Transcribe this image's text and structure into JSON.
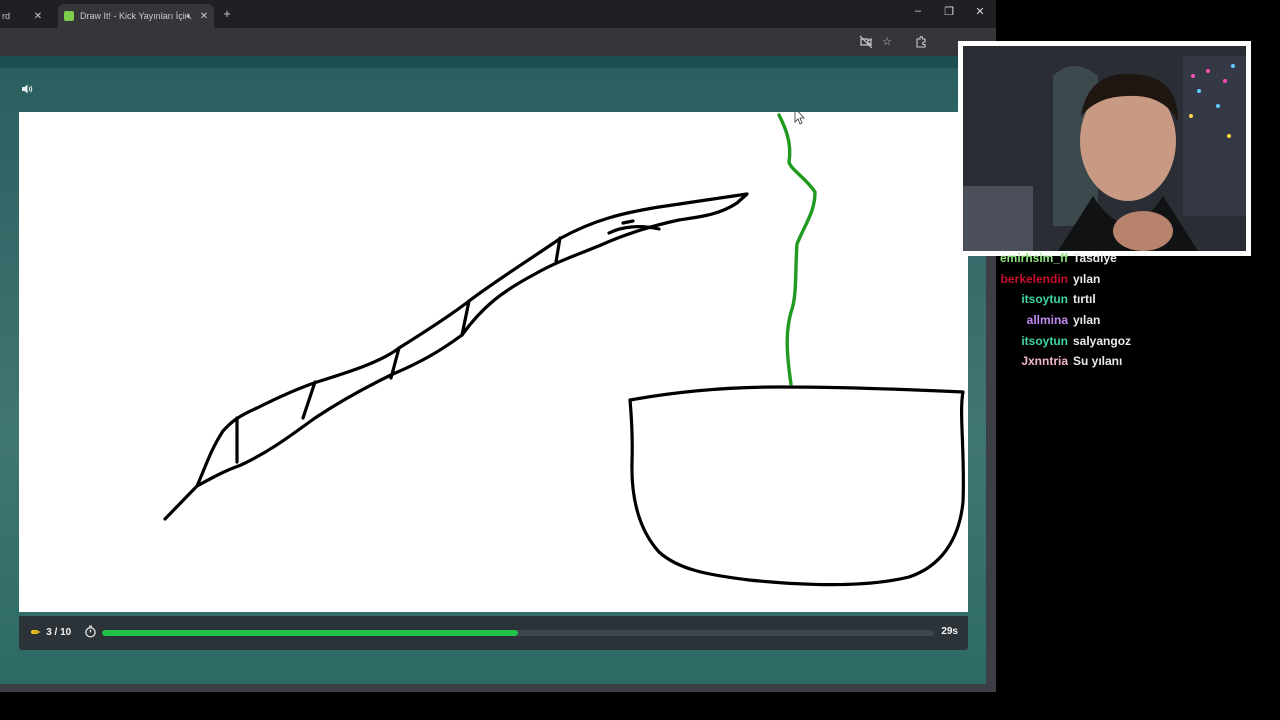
{
  "browser": {
    "tabs": [
      {
        "title": "rd",
        "active": false
      },
      {
        "title": "Draw It! - Kick Yayınları İçin",
        "active": true
      }
    ],
    "new_tab": "+",
    "window_controls": {
      "minimize": "–",
      "restore": "❐",
      "close": "✕"
    }
  },
  "game": {
    "round_label": "3 / 10",
    "seconds_left": "29s",
    "timer_progress_percent": 50,
    "colors": {
      "ink": "#000000",
      "green_ink": "#1f9a1f",
      "progress": "#22c24a",
      "pencil": "#f3c316"
    }
  },
  "chat": {
    "messages": [
      {
        "user": "emirhsim_ff",
        "text": "Tasdiye",
        "color": "#8fe07f"
      },
      {
        "user": "berkelendin",
        "text": "yılan",
        "color": "#c8102e"
      },
      {
        "user": "itsoytun",
        "text": "tırtıl",
        "color": "#3fd3a5"
      },
      {
        "user": "allmina",
        "text": "yılan",
        "color": "#c08cf2"
      },
      {
        "user": "itsoytun",
        "text": "salyangoz",
        "color": "#3fd3a5"
      },
      {
        "user": "Jxnntria",
        "text": "Su yılanı",
        "color": "#f0b6c8"
      }
    ]
  }
}
